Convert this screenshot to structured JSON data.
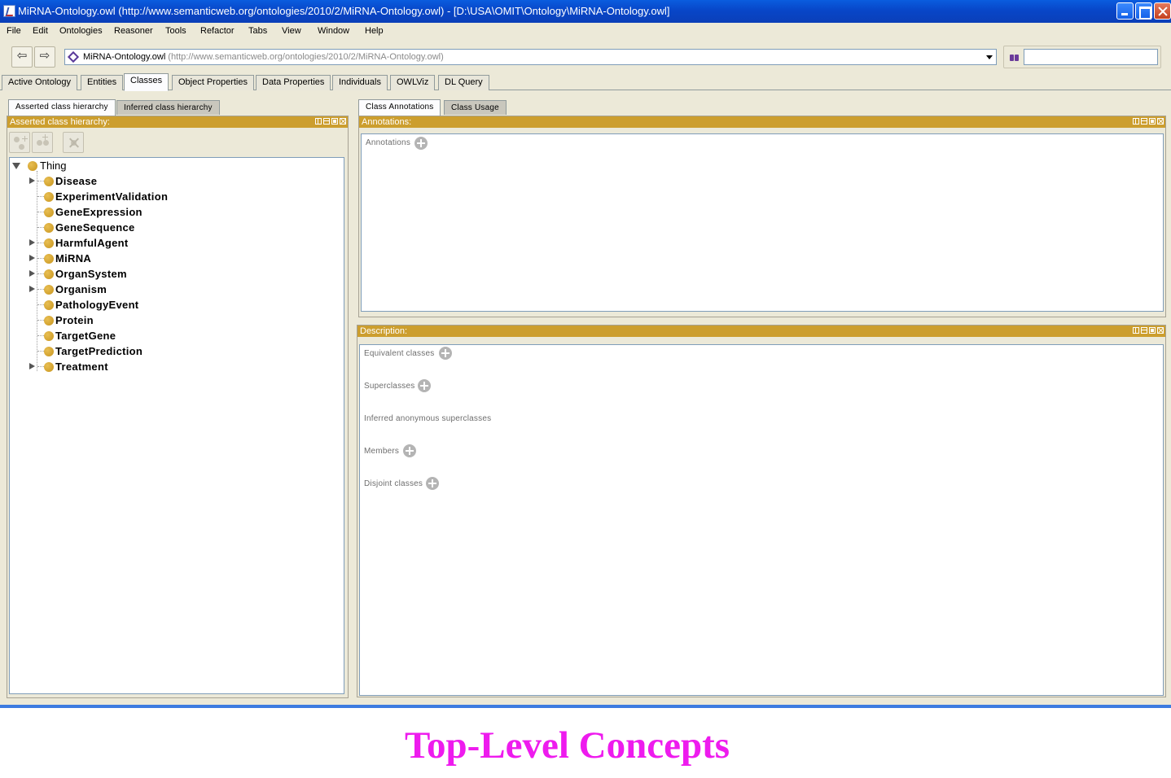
{
  "window": {
    "title": "MiRNA-Ontology.owl (http://www.semanticweb.org/ontologies/2010/2/MiRNA-Ontology.owl) - [D:\\USA\\OMIT\\Ontology\\MiRNA-Ontology.owl]"
  },
  "menu": [
    "File",
    "Edit",
    "Ontologies",
    "Reasoner",
    "Tools",
    "Refactor",
    "Tabs",
    "View",
    "Window",
    "Help"
  ],
  "toolbar": {
    "back_icon": "⇦",
    "forward_icon": "⇨",
    "ontology_name": "MiRNA-Ontology.owl",
    "ontology_uri": "(http://www.semanticweb.org/ontologies/2010/2/MiRNA-Ontology.owl)",
    "search_value": ""
  },
  "main_tabs": [
    "Active Ontology",
    "Entities",
    "Classes",
    "Object Properties",
    "Data Properties",
    "Individuals",
    "OWLViz",
    "DL Query"
  ],
  "active_main_tab": "Classes",
  "left": {
    "tabs": [
      "Asserted class hierarchy",
      "Inferred class hierarchy"
    ],
    "view_title": "Asserted class hierarchy:",
    "tree": {
      "root": "Thing",
      "children": [
        {
          "label": "Disease",
          "expandable": true
        },
        {
          "label": "ExperimentValidation",
          "expandable": false
        },
        {
          "label": "GeneExpression",
          "expandable": false
        },
        {
          "label": "GeneSequence",
          "expandable": false
        },
        {
          "label": "HarmfulAgent",
          "expandable": true
        },
        {
          "label": "MiRNA",
          "expandable": true
        },
        {
          "label": "OrganSystem",
          "expandable": true
        },
        {
          "label": "Organism",
          "expandable": true
        },
        {
          "label": "PathologyEvent",
          "expandable": false
        },
        {
          "label": "Protein",
          "expandable": false
        },
        {
          "label": "TargetGene",
          "expandable": false
        },
        {
          "label": "TargetPrediction",
          "expandable": false
        },
        {
          "label": "Treatment",
          "expandable": true
        }
      ]
    }
  },
  "right": {
    "tabs": [
      "Class Annotations",
      "Class Usage"
    ],
    "annotations_view": {
      "title": "Annotations:",
      "section": "Annotations"
    },
    "description_view": {
      "title": "Description:",
      "sections": [
        "Equivalent classes",
        "Superclasses",
        "Inferred anonymous superclasses",
        "Members",
        "Disjoint classes"
      ]
    }
  },
  "caption": "Top-Level Concepts",
  "colors": {
    "view_header": "#cc9e2e",
    "class_icon": "#d4a032",
    "caption": "#ee1bee",
    "titlebar": "#0a4fd6"
  }
}
